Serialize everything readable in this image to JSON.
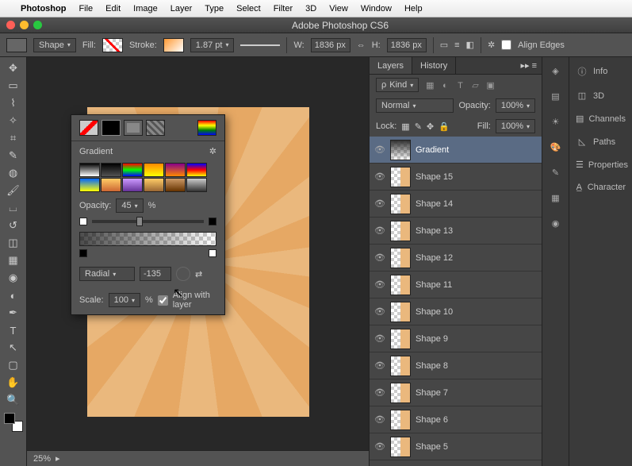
{
  "menubar": {
    "items": [
      "Photoshop",
      "File",
      "Edit",
      "Image",
      "Layer",
      "Type",
      "Select",
      "Filter",
      "3D",
      "View",
      "Window",
      "Help"
    ]
  },
  "titlebar": {
    "title": "Adobe Photoshop CS6"
  },
  "optbar": {
    "shape": "Shape",
    "fill": "Fill:",
    "stroke": "Stroke:",
    "stroke_w": "1.87 pt",
    "w_label": "W:",
    "w": "1836 px",
    "h_label": "H:",
    "h": "1836 px",
    "align": "Align Edges"
  },
  "gradient": {
    "title": "Gradient",
    "opacity_label": "Opacity:",
    "opacity": "45",
    "pct": "%",
    "type": "Radial",
    "angle": "-135",
    "scale_label": "Scale:",
    "scale": "100",
    "align_label": "Align with layer"
  },
  "layers_panel": {
    "tabs": [
      "Layers",
      "History"
    ],
    "kind": "Kind",
    "blend": "Normal",
    "opacity_label": "Opacity:",
    "opacity": "100%",
    "lock_label": "Lock:",
    "fill_label": "Fill:",
    "fill": "100%",
    "layers": [
      "Gradient",
      "Shape 15",
      "Shape 14",
      "Shape 13",
      "Shape 12",
      "Shape 11",
      "Shape 10",
      "Shape 9",
      "Shape 8",
      "Shape 7",
      "Shape 6",
      "Shape 5"
    ]
  },
  "side": {
    "items": [
      "Info",
      "3D",
      "Channels",
      "Paths",
      "Properties",
      "Character"
    ]
  },
  "status": {
    "zoom": "25%"
  }
}
